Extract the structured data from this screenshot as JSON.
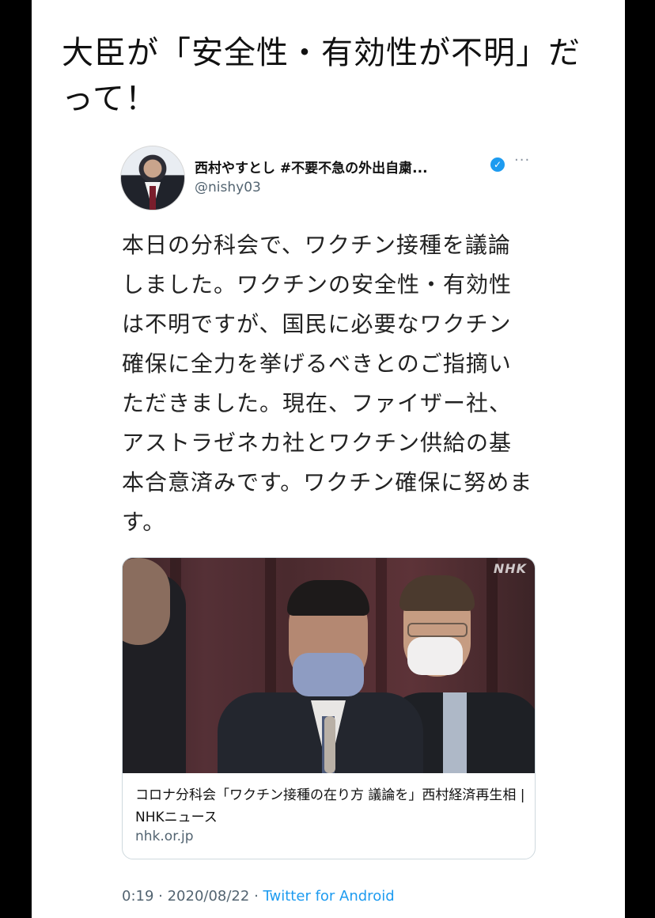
{
  "headline": {
    "text": "大臣が「安全性・有効性が不明」だって！"
  },
  "tweet": {
    "author_name": "西村やすとし #不要不急の外出自粛...",
    "author_handle": "@nishy03",
    "verified_icon": "verified-check-icon",
    "more_icon": "more-options-icon",
    "text": "本日の分科会で、ワクチン接種を議論しました。ワクチンの安全性・有効性は不明ですが、国民に必要なワクチン確保に全力を挙げるべきとのご指摘いただきました。現在、ファイザー社、アストラゼネカ社とワクチン供給の基本合意済みです。ワクチン確保に努めます。",
    "card": {
      "image_watermark": "NHK",
      "title": "コロナ分科会「ワクチン接種の在り方 議論を」西村経済再生相 | NHKニュース",
      "domain": "nhk.or.jp"
    },
    "footer": {
      "time": "0:19",
      "separator1": " · ",
      "date": "2020/08/22",
      "separator2": " · ",
      "source": "Twitter for Android"
    }
  },
  "colors": {
    "background": "#000000",
    "page": "#ffffff",
    "link_blue": "#1d9bf0",
    "secondary_text": "#536471"
  }
}
